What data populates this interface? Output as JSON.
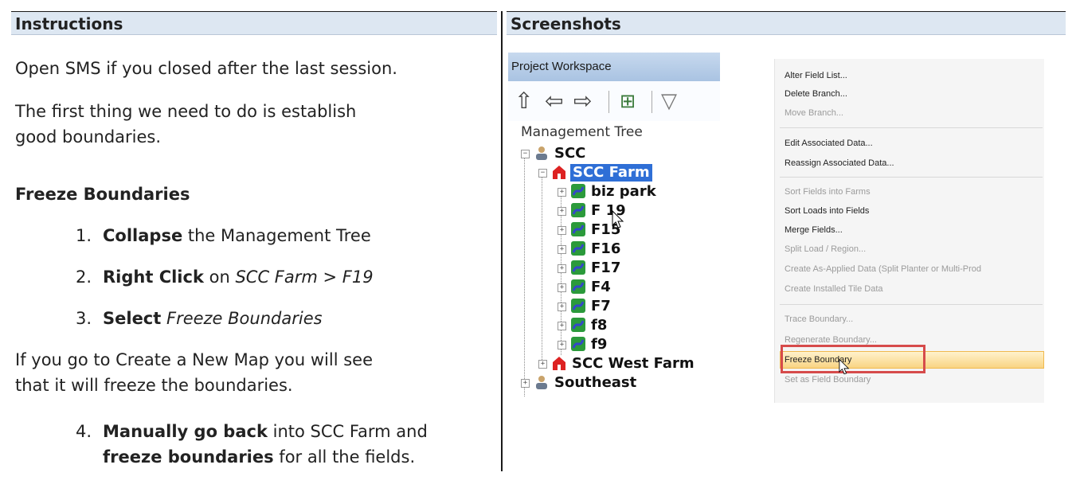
{
  "headers": {
    "left": "Instructions",
    "right": "Screenshots"
  },
  "instructions": {
    "p1": "Open SMS if you closed after the last session.",
    "p2a": "The first thing we need to do is establish",
    "p2b": "good boundaries.",
    "section": "Freeze Boundaries",
    "steps": [
      {
        "num": "1.",
        "bold": "Collapse",
        "rest": " the Management Tree",
        "italic": ""
      },
      {
        "num": "2.",
        "bold": "Right Click",
        "rest": " on ",
        "italic": "SCC Farm > F19"
      },
      {
        "num": "3.",
        "bold": "Select",
        "rest": " ",
        "italic": "Freeze Boundaries"
      }
    ],
    "p3a": "If you go to Create a New Map you will see",
    "p3b": "that it will freeze the boundaries.",
    "step4": {
      "num": "4.",
      "bold1": "Manually go back",
      "rest1": " into SCC Farm and",
      "bold2": "freeze boundaries",
      "rest2": " for all the fields."
    }
  },
  "workspace": {
    "title": "Project Workspace",
    "tree_label": "Management Tree",
    "nodes": [
      {
        "label": "SCC",
        "expander": "−"
      },
      {
        "label": "SCC Farm",
        "expander": "−"
      },
      {
        "label": "biz park",
        "expander": "+"
      },
      {
        "label": "F 19",
        "expander": "+"
      },
      {
        "label": "F15",
        "expander": "+"
      },
      {
        "label": "F16",
        "expander": "+"
      },
      {
        "label": "F17",
        "expander": "+"
      },
      {
        "label": "F4",
        "expander": "+"
      },
      {
        "label": "F7",
        "expander": "+"
      },
      {
        "label": "f8",
        "expander": "+"
      },
      {
        "label": "f9",
        "expander": "+"
      },
      {
        "label": "SCC West Farm",
        "expander": "+"
      },
      {
        "label": "Southeast",
        "expander": "+"
      }
    ]
  },
  "context_menu": {
    "items": [
      {
        "label": "Alter Field List...",
        "enabled": true
      },
      {
        "label": "Delete Branch...",
        "enabled": true
      },
      {
        "label": "Move Branch...",
        "enabled": false
      },
      {
        "label": "Edit Associated Data...",
        "enabled": true
      },
      {
        "label": "Reassign Associated Data...",
        "enabled": true
      },
      {
        "label": "Sort Fields into Farms",
        "enabled": false
      },
      {
        "label": "Sort Loads into Fields",
        "enabled": true
      },
      {
        "label": "Merge Fields...",
        "enabled": true
      },
      {
        "label": "Split Load / Region...",
        "enabled": false
      },
      {
        "label": "Create As-Applied Data (Split Planter or Multi-Prod",
        "enabled": false
      },
      {
        "label": "Create Installed Tile Data",
        "enabled": false
      },
      {
        "label": "Trace Boundary...",
        "enabled": false
      },
      {
        "label": "Regenerate Boundary...",
        "enabled": false
      },
      {
        "label": "Freeze Boundary",
        "enabled": true
      },
      {
        "label": "Set as Field Boundary",
        "enabled": false
      }
    ],
    "highlight_color": "#f9d483",
    "callout_color": "#d64b4b"
  }
}
